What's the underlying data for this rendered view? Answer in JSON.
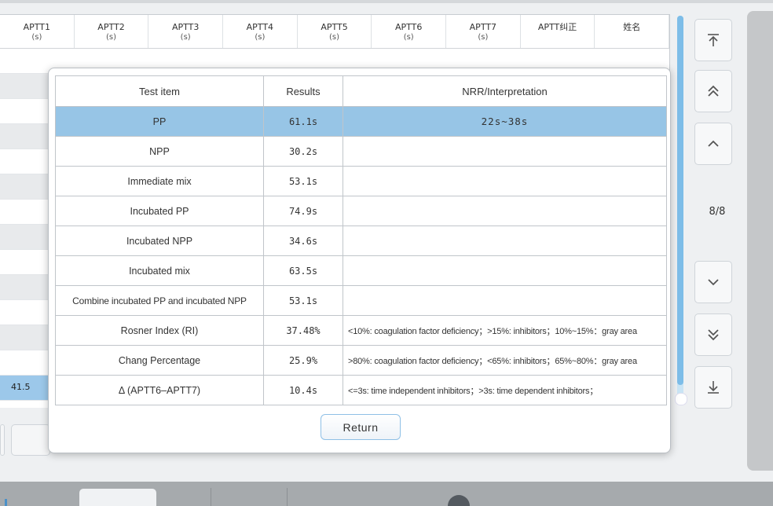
{
  "background_table": {
    "headers": [
      {
        "label": "APTT1",
        "unit": "(s)"
      },
      {
        "label": "APTT2",
        "unit": "(s)"
      },
      {
        "label": "APTT3",
        "unit": "(s)"
      },
      {
        "label": "APTT4",
        "unit": "(s)"
      },
      {
        "label": "APTT5",
        "unit": "(s)"
      },
      {
        "label": "APTT6",
        "unit": "(s)"
      },
      {
        "label": "APTT7",
        "unit": "(s)"
      },
      {
        "label": "APTT纠正",
        "unit": ""
      },
      {
        "label": "姓名",
        "unit": ""
      }
    ],
    "selected_row_value": "41.5"
  },
  "navigation": {
    "page_indicator": "8/8",
    "buttons": [
      "first-page",
      "page-up-fast",
      "page-up",
      "page-down",
      "page-down-fast",
      "last-page"
    ]
  },
  "dialog": {
    "columns": [
      "Test item",
      "Results",
      "NRR/Interpretation"
    ],
    "rows": [
      {
        "item": "PP",
        "result": "61.1s",
        "interpretation": "22s~38s",
        "selected": true
      },
      {
        "item": "NPP",
        "result": "30.2s",
        "interpretation": ""
      },
      {
        "item": "Immediate mix",
        "result": "53.1s",
        "interpretation": ""
      },
      {
        "item": "Incubated PP",
        "result": "74.9s",
        "interpretation": ""
      },
      {
        "item": "Incubated NPP",
        "result": "34.6s",
        "interpretation": ""
      },
      {
        "item": "Incubated mix",
        "result": "63.5s",
        "interpretation": ""
      },
      {
        "item": "Combine incubated PP and incubated NPP",
        "result": "53.1s",
        "interpretation": ""
      },
      {
        "item": "Rosner   Index (RI)",
        "result": "37.48%",
        "interpretation": "<10%: coagulation factor deficiency；>15%: inhibitors；10%~15%：gray area"
      },
      {
        "item": "Chang Percentage",
        "result": "25.9%",
        "interpretation": ">80%: coagulation factor deficiency；<65%: inhibitors；65%~80%：gray area"
      },
      {
        "item": "Δ (APTT6–APTT7)",
        "result": "10.4s",
        "interpretation": "<=3s: time independent inhibitors；>3s: time dependent inhibitors；"
      }
    ],
    "return_label": "Return"
  },
  "colors": {
    "selected_row": "#97c5e6",
    "accent_border": "#8fc0e6",
    "scrollbar": "#7dbde8"
  }
}
